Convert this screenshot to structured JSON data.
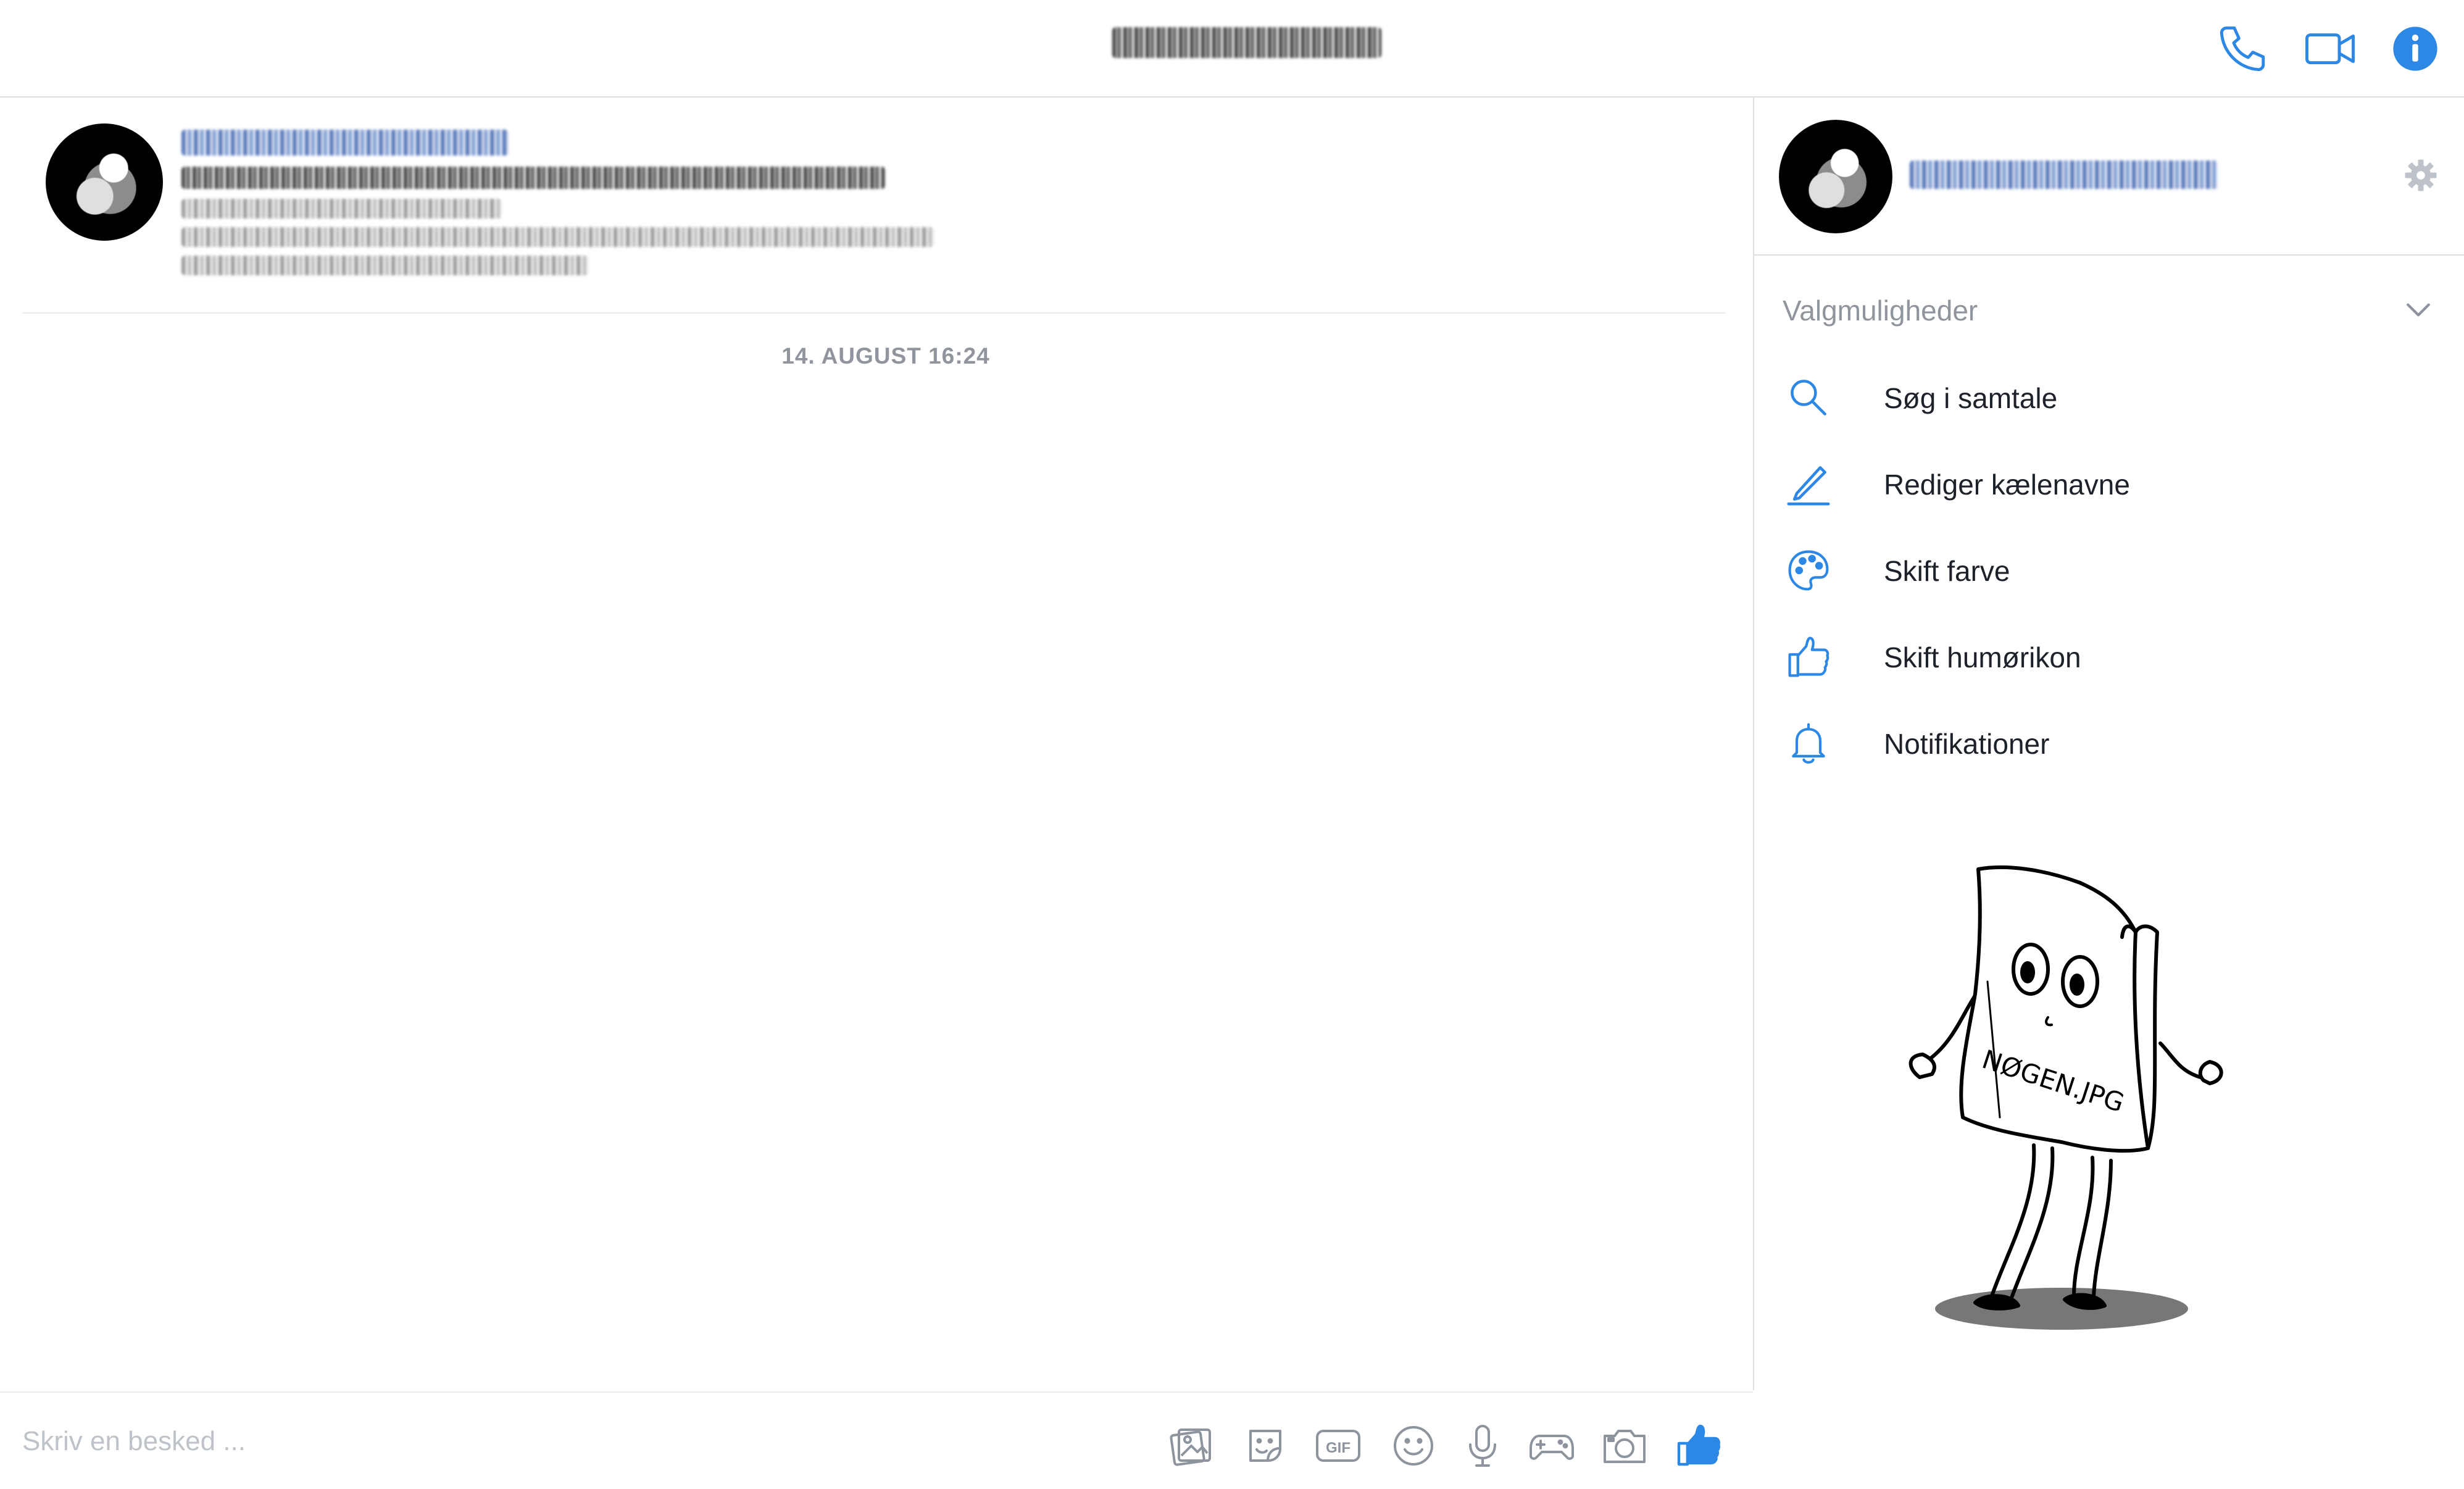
{
  "header": {
    "call_icon": "phone-icon",
    "video_icon": "video-camera-icon",
    "info_icon": "info-icon",
    "accent": "#2d88e5"
  },
  "chat": {
    "timestamp": "14. AUGUST 16:24",
    "composer": {
      "placeholder": "Skriv en besked ...",
      "value": ""
    },
    "composer_icons": [
      "photo-icon",
      "sticker-icon",
      "gif-icon",
      "emoji-icon",
      "microphone-icon",
      "game-controller-icon",
      "camera-icon",
      "like-icon"
    ],
    "gif_label": "GIF"
  },
  "panel": {
    "settings_icon": "gear-icon",
    "options_title": "Valgmuligheder",
    "options": [
      {
        "label": "Søg i samtale",
        "icon": "search-icon"
      },
      {
        "label": "Rediger kælenavne",
        "icon": "pencil-icon"
      },
      {
        "label": "Skift farve",
        "icon": "palette-icon"
      },
      {
        "label": "Skift humørikon",
        "icon": "thumbs-up-icon"
      },
      {
        "label": "Notifikationer",
        "icon": "bell-icon"
      }
    ],
    "illustration_label": "NØGEN.JPG"
  }
}
